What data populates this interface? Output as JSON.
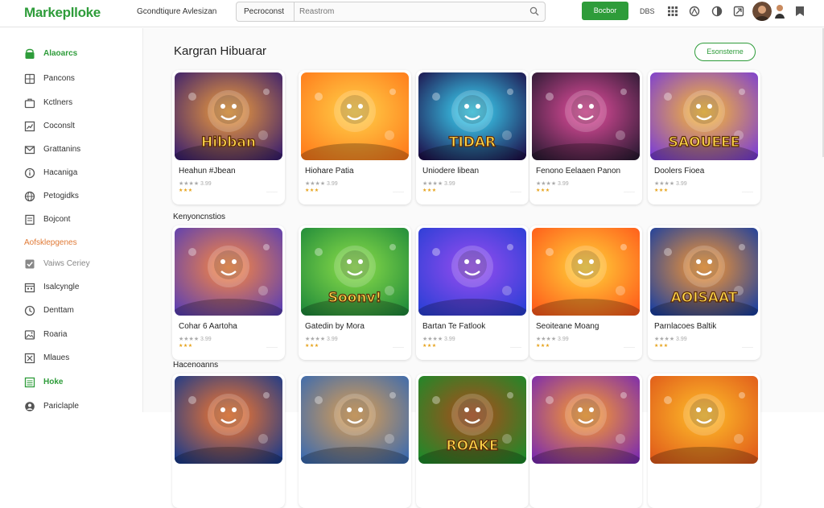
{
  "header": {
    "logo": "Markeplloke",
    "nav_text": "Gcondtiqure Avlesizan",
    "search_category": "Pecroconst",
    "search_placeholder": "Reastrom",
    "cta_label": "Bocbor",
    "meta_label": "DBS"
  },
  "sidebar": {
    "items": [
      {
        "label": "Alaoarcs",
        "icon": "store-icon",
        "state": "active"
      },
      {
        "label": "Pancons",
        "icon": "grid-icon",
        "state": ""
      },
      {
        "label": "Kctlners",
        "icon": "briefcase-icon",
        "state": ""
      },
      {
        "label": "Coconslt",
        "icon": "chart-icon",
        "state": ""
      },
      {
        "label": "Grattanins",
        "icon": "mail-icon",
        "state": ""
      },
      {
        "label": "Hacaniga",
        "icon": "info-icon",
        "state": ""
      },
      {
        "label": "Petogidks",
        "icon": "globe-icon",
        "state": ""
      },
      {
        "label": "Bojcont",
        "icon": "document-icon",
        "state": ""
      },
      {
        "label": "Aofsklepgenes",
        "icon": "",
        "state": "section"
      },
      {
        "label": "Vaiws Ceriey",
        "icon": "check-icon",
        "state": "muted"
      },
      {
        "label": "Isalcyngle",
        "icon": "calendar-icon",
        "state": ""
      },
      {
        "label": "Denttam",
        "icon": "clock-icon",
        "state": ""
      },
      {
        "label": "Roaria",
        "icon": "image-icon",
        "state": ""
      },
      {
        "label": "Mlaues",
        "icon": "table-icon",
        "state": ""
      },
      {
        "label": "Hoke",
        "icon": "list-icon",
        "state": "active"
      },
      {
        "label": "Pariclaple",
        "icon": "user-icon",
        "state": ""
      }
    ]
  },
  "main": {
    "title": "Kargran Hibuarar",
    "outline_button": "Esonsterne",
    "section2": "Kenyoncnstios",
    "section3": "Hacenoanns",
    "rows": [
      [
        {
          "title": "Heahun #Jbean",
          "sub": "★★★★ 3.99",
          "stars": "★★★",
          "meta": "·······",
          "art": "Hibban"
        },
        {
          "title": "Hiohare Patia",
          "sub": "★★★★ 3.99",
          "stars": "★★★",
          "meta": "·······",
          "art": ""
        },
        {
          "title": "Uniodere libean",
          "sub": "★★★★ 3.99",
          "stars": "★★★",
          "meta": "·······",
          "art": "TIDAR"
        },
        {
          "title": "Fenono Eelaaen Panon",
          "sub": "★★★★ 3.99",
          "stars": "★★★",
          "meta": "·······",
          "art": ""
        },
        {
          "title": "Doolers Fioea",
          "sub": "★★★★ 3.99",
          "stars": "★★★",
          "meta": "·······",
          "art": "SAOUEEE"
        }
      ],
      [
        {
          "title": "Cohar 6 Aartoha",
          "sub": "★★★★ 3.99",
          "stars": "★★★",
          "meta": "·······",
          "art": ""
        },
        {
          "title": "Gatedin by Mora",
          "sub": "★★★★ 3.99",
          "stars": "★★★",
          "meta": "·······",
          "art": "Soonv!"
        },
        {
          "title": "Bartan Te Fatlook",
          "sub": "★★★★ 3.99",
          "stars": "★★★",
          "meta": "·······",
          "art": ""
        },
        {
          "title": "Seoiteane Moang",
          "sub": "★★★★ 3.99",
          "stars": "★★★",
          "meta": "·······",
          "art": ""
        },
        {
          "title": "Parnlacoes Baltik",
          "sub": "★★★★ 3.99",
          "stars": "★★★",
          "meta": "·······",
          "art": "AOISAAT"
        }
      ],
      [
        {
          "art": ""
        },
        {
          "art": ""
        },
        {
          "art": "ROAKE"
        },
        {
          "art": ""
        },
        {
          "art": ""
        }
      ]
    ]
  }
}
